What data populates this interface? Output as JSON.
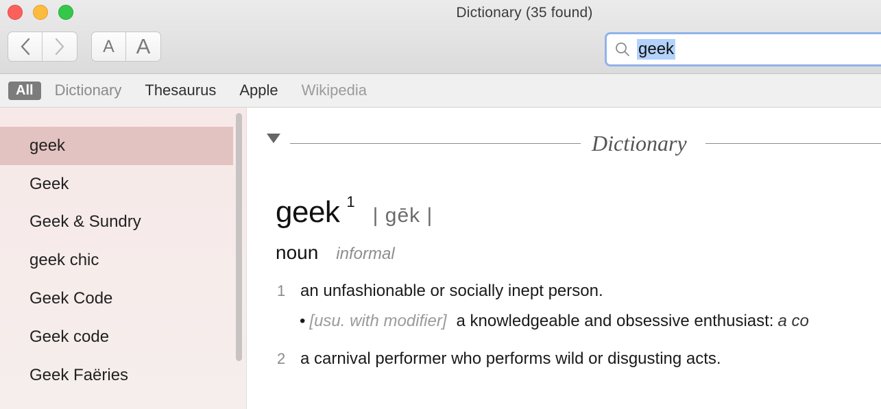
{
  "window": {
    "title": "Dictionary (35 found)"
  },
  "toolbar": {
    "back_icon": "chevron-left-icon",
    "forward_icon": "chevron-right-icon",
    "font_smaller_label": "A",
    "font_larger_label": "A"
  },
  "search": {
    "icon": "magnifier-icon",
    "value": "geek"
  },
  "filters": [
    {
      "label": "All",
      "state": "active"
    },
    {
      "label": "Dictionary",
      "state": "dim"
    },
    {
      "label": "Thesaurus",
      "state": "normal"
    },
    {
      "label": "Apple",
      "state": "normal"
    },
    {
      "label": "Wikipedia",
      "state": "dim"
    }
  ],
  "sidebar": {
    "items": [
      {
        "label": "geek",
        "selected": true
      },
      {
        "label": "Geek",
        "selected": false
      },
      {
        "label": "Geek & Sundry",
        "selected": false
      },
      {
        "label": "geek chic",
        "selected": false
      },
      {
        "label": "Geek Code",
        "selected": false
      },
      {
        "label": "Geek code",
        "selected": false
      },
      {
        "label": "Geek Faëries",
        "selected": false
      }
    ]
  },
  "content": {
    "section_title": "Dictionary",
    "entry": {
      "headword": "geek",
      "homograph": "1",
      "pronunciation": "| gēk |",
      "part_of_speech": "noun",
      "register": "informal",
      "senses": [
        {
          "number": "1",
          "definition": "an unfashionable or socially inept person.",
          "subsense": {
            "bullet": "•",
            "grammar": "[usu. with modifier]",
            "definition": "a knowledgeable and obsessive enthusiast:",
            "example": "a co"
          }
        },
        {
          "number": "2",
          "definition": "a carnival performer who performs wild or disgusting acts."
        }
      ]
    }
  },
  "colors": {
    "selection_bg": "#e3c3c1",
    "search_focus": "#8fb3ea",
    "search_highlight": "#b3d2fb"
  }
}
